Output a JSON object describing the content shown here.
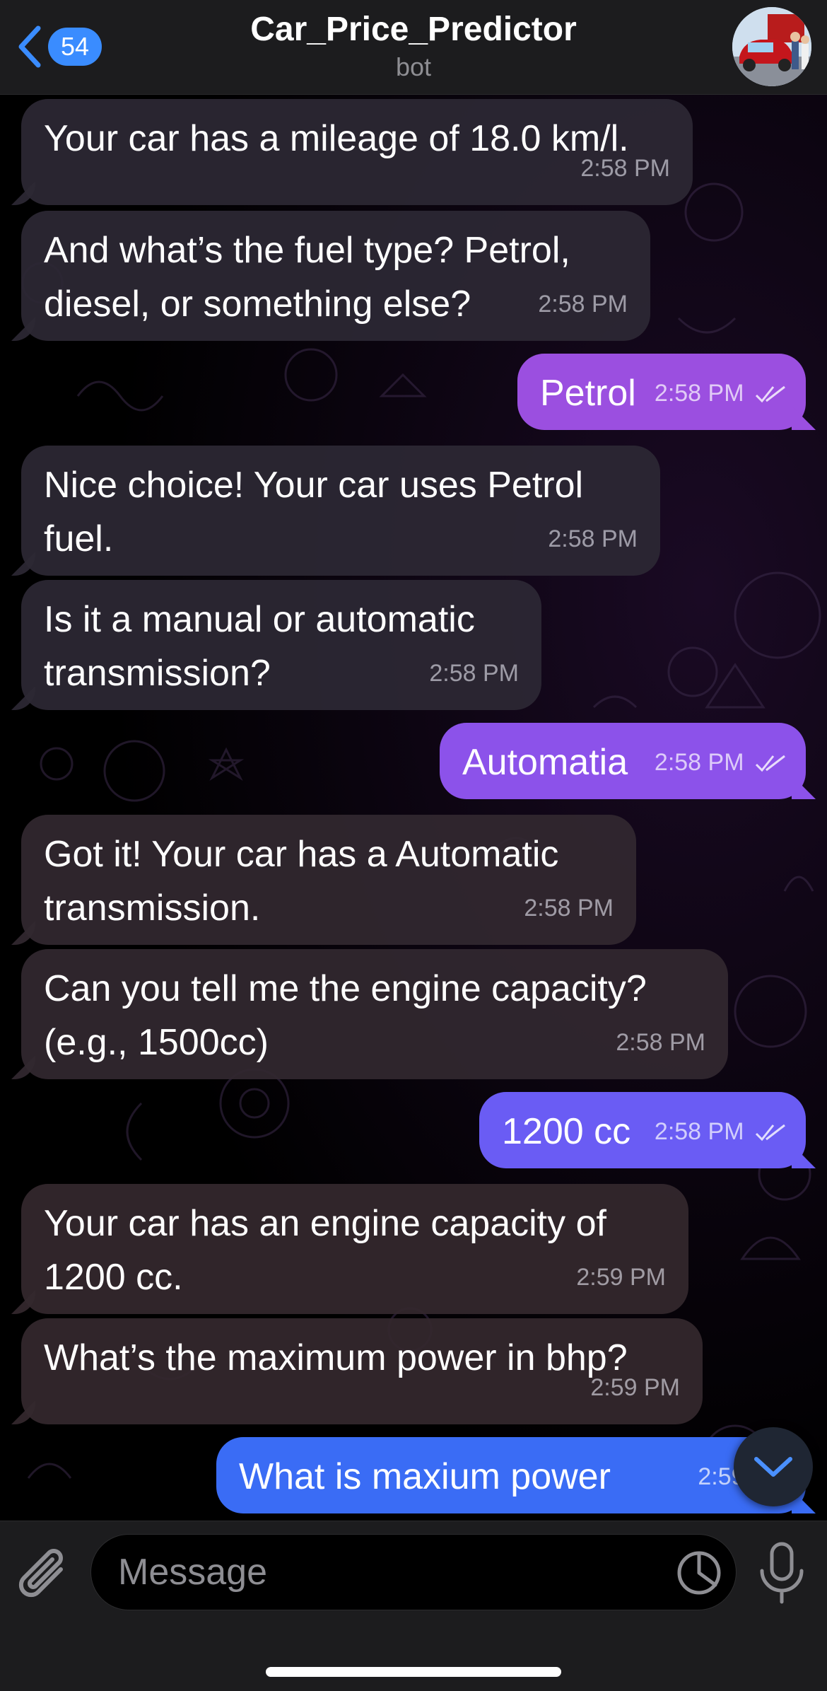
{
  "header": {
    "unread_count": "54",
    "title": "Car_Price_Predictor",
    "subtitle": "bot"
  },
  "messages": [
    {
      "dir": "in",
      "text": "Your car has a mileage of 18.0 km/l.",
      "time": "2:58 PM"
    },
    {
      "dir": "in",
      "text": "And what’s the fuel type? Petrol, diesel, or something else?",
      "time": "2:58 PM"
    },
    {
      "dir": "out",
      "text": "Petrol",
      "time": "2:58 PM"
    },
    {
      "dir": "in",
      "text": "Nice choice! Your car uses Petrol fuel.",
      "time": "2:58 PM"
    },
    {
      "dir": "in",
      "text": "Is it a manual or automatic transmission?",
      "time": "2:58 PM"
    },
    {
      "dir": "out",
      "text": "Automatia",
      "time": "2:58 PM"
    },
    {
      "dir": "in",
      "text": "Got it! Your car has a Automatic transmission.",
      "time": "2:58 PM"
    },
    {
      "dir": "in",
      "text": "Can you tell me the engine capacity? (e.g., 1500cc)",
      "time": "2:58 PM"
    },
    {
      "dir": "out",
      "text": "1200 cc",
      "time": "2:58 PM"
    },
    {
      "dir": "in",
      "text": "Your car has an engine capacity of 1200 cc.",
      "time": "2:59 PM"
    },
    {
      "dir": "in",
      "text": "What’s the maximum power in bhp?",
      "time": "2:59 PM"
    },
    {
      "dir": "out",
      "text": "What is maxium power",
      "time": "2:59 PM"
    }
  ],
  "composer": {
    "placeholder": "Message"
  },
  "icons": {
    "back": "chevron-left-icon",
    "attach": "paperclip-icon",
    "sticker": "sticker-icon",
    "mic": "microphone-icon",
    "scroll": "chevron-down-icon",
    "read": "double-check-icon"
  },
  "colors": {
    "accent": "#3a8cff",
    "incoming_bubble": "#2c2834",
    "outgoing_top": "#9b4fe0",
    "outgoing_bottom": "#3a6cf5"
  }
}
